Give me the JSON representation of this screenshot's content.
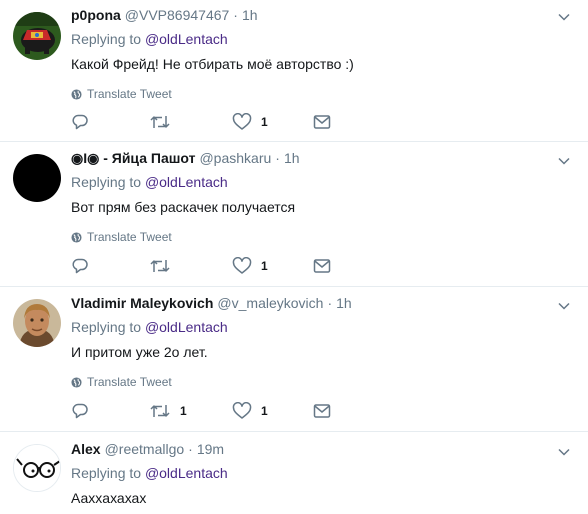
{
  "replying_prefix": "Replying to",
  "translate_label": "Translate Tweet",
  "tweets": [
    {
      "name": "p0pona",
      "handle": "@VVP86947467",
      "separator": "·",
      "time": "1h",
      "reply_to": "@oldLentach",
      "text": "Какой Фрейд! Не отбирать моё авторство :)",
      "retweets": "",
      "likes": "1"
    },
    {
      "name": "◉I◉ - Яйца Пашот",
      "handle": "@pashkaru",
      "separator": "·",
      "time": "1h",
      "reply_to": "@oldLentach",
      "text": "Вот прям без раскачек получается",
      "retweets": "",
      "likes": "1"
    },
    {
      "name": "Vladimir Maleykovich",
      "handle": "@v_maleykovich",
      "separator": "·",
      "time": "1h",
      "reply_to": "@oldLentach",
      "text": "И притом уже 2о лет.",
      "retweets": "1",
      "likes": "1"
    },
    {
      "name": "Alex",
      "handle": "@reetmallgo",
      "separator": "·",
      "time": "19m",
      "reply_to": "@oldLentach",
      "text": "Аахxахахах"
    }
  ],
  "colors": {
    "reply_link": "#4a2b87",
    "secondary_text": "#657786",
    "icon": "#657786",
    "divider": "#e6ecf0"
  }
}
